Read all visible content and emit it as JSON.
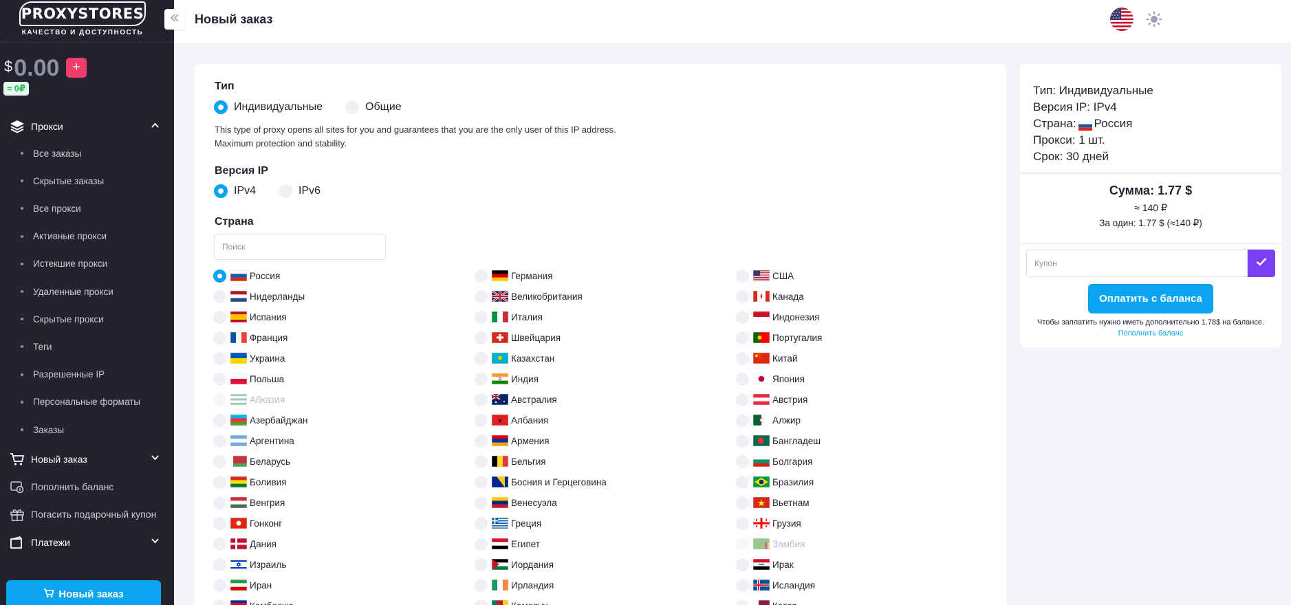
{
  "brand": {
    "name": "PROXYSTORES",
    "tagline": "КАЧЕСТВО И ДОСТУПНОСТЬ"
  },
  "balance": {
    "currency": "$",
    "amount": "0.00",
    "add_label": "+",
    "rub": "≈ 0₽"
  },
  "sidebar": {
    "proxies_group": {
      "label": "Прокси",
      "icon": "layers-icon"
    },
    "sub_items": [
      "Все заказы",
      "Скрытые заказы",
      "Все прокси",
      "Активные прокси",
      "Истекшие прокси",
      "Удаленные прокси",
      "Скрытые прокси",
      "Теги",
      "Разрешенные IP",
      "Персональные форматы",
      "Заказы"
    ],
    "new_order_group": {
      "label": "Новый заказ",
      "icon": "cart-icon"
    },
    "topup": {
      "label": "Пополнить баланс",
      "icon": "wallet-icon"
    },
    "gift": {
      "label": "Погасить подарочный купон",
      "icon": "gift-icon"
    },
    "payments_group": {
      "label": "Платежи",
      "icon": "folder-icon"
    },
    "new_order_button": "Новый заказ"
  },
  "header": {
    "title": "Новый заказ",
    "language_flag": "us-flag-icon",
    "theme_icon": "sun-icon"
  },
  "form": {
    "type_label": "Тип",
    "type_options": [
      "Индивидуальные",
      "Общие"
    ],
    "type_selected": "Индивидуальные",
    "type_description_1": "This type of proxy opens all sites for you and guarantees that you are the only user of this IP address.",
    "type_description_2": "Maximum protection and stability.",
    "ip_label": "Версия IP",
    "ip_options": [
      "IPv4",
      "IPv6"
    ],
    "ip_selected": "IPv4",
    "country_label": "Страна",
    "search_placeholder": "Поиск"
  },
  "countries": {
    "col1": [
      "Россия",
      "Нидерланды",
      "Испания",
      "Франция",
      "Украина",
      "Польша",
      "Абхазия",
      "Азербайджан",
      "Аргентина",
      "Беларусь",
      "Боливия",
      "Венгрия",
      "Гонконг",
      "Дания",
      "Израиль",
      "Иран",
      "Камбоджа"
    ],
    "col2": [
      "Германия",
      "Великобритания",
      "Италия",
      "Швейцария",
      "Казахстан",
      "Индия",
      "Австралия",
      "Албания",
      "Армения",
      "Бельгия",
      "Босния и Герцеговина",
      "Венесуэла",
      "Греция",
      "Египет",
      "Иордания",
      "Ирландия",
      "Камерун"
    ],
    "col3": [
      "США",
      "Канада",
      "Индонезия",
      "Португалия",
      "Китай",
      "Япония",
      "Австрия",
      "Алжир",
      "Бангладеш",
      "Болгария",
      "Бразилия",
      "Вьетнам",
      "Грузия",
      "Замбия",
      "Ирак",
      "Исландия",
      "Катар"
    ],
    "selected": "Россия",
    "disabled": [
      "Абхазия",
      "Замбия"
    ]
  },
  "summary": {
    "type_line": "Тип: Индивидуальные",
    "ip_line": "Версия IP: IPv4",
    "country_prefix": "Страна:",
    "country_value": "Россия",
    "proxies_line": "Прокси: 1 шт.",
    "term_line": "Срок: 30 дней",
    "total": "Сумма: 1.77 $",
    "total_rub": "≈ 140 ₽",
    "per_one": "За один: 1.77 $ (≈140 ₽)",
    "coupon_placeholder": "Купон",
    "pay_button": "Оплатить с баланса",
    "pay_note": "Чтобы заплатить нужно иметь дополнительно 1.78$ на балансе.",
    "topup_link": "Пополнить баланс"
  },
  "colors": {
    "accent": "#0ba4f0",
    "sidebar_bg": "#22232f",
    "add_button": "#ef3d6b",
    "coupon_button": "#7a3ff0"
  }
}
